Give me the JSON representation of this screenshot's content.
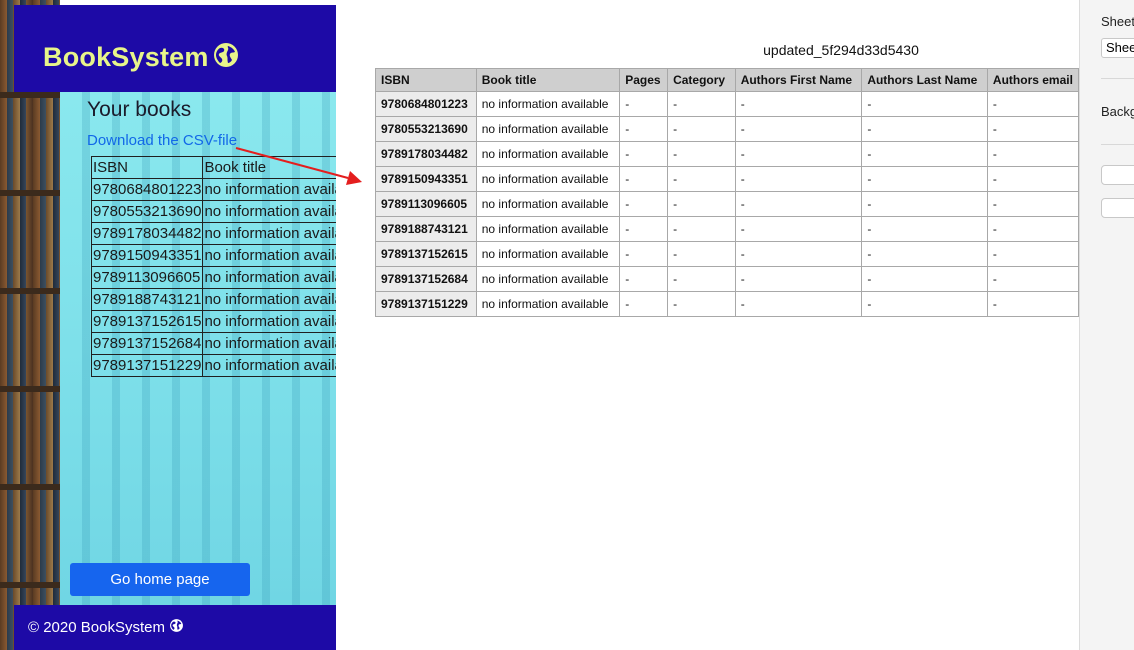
{
  "app": {
    "brand": "BookSystem",
    "heading": "Your books",
    "csv_link": "Download the CSV-file",
    "table": {
      "headers": [
        "ISBN",
        "Book title"
      ],
      "rows": [
        [
          "9780684801223",
          "no information available"
        ],
        [
          "9780553213690",
          "no information available"
        ],
        [
          "9789178034482",
          "no information available"
        ],
        [
          "9789150943351",
          "no information available"
        ],
        [
          "9789113096605",
          "no information available"
        ],
        [
          "9789188743121",
          "no information available"
        ],
        [
          "9789137152615",
          "no information available"
        ],
        [
          "9789137152684",
          "no information available"
        ],
        [
          "9789137151229",
          "no information available"
        ]
      ]
    },
    "home_button": "Go home page",
    "footer": "© 2020 BookSystem",
    "colors": {
      "header": "#1d0aa6",
      "brand_text": "#e8f58a",
      "link": "#1268e8",
      "button": "#1665ee",
      "hero": "#7ee0ea"
    },
    "icons": {
      "brand": "globe-icon",
      "footer": "globe-icon"
    }
  },
  "sheet": {
    "title": "updated_5f294d33d5430",
    "columns": [
      "ISBN",
      "Book title",
      "Pages",
      "Category",
      "Authors First Name",
      "Authors Last Name",
      "Authors email"
    ],
    "rows": [
      [
        "9780684801223",
        "no information available",
        "-",
        "-",
        "-",
        "-",
        "-"
      ],
      [
        "9780553213690",
        "no information available",
        "-",
        "-",
        "-",
        "-",
        "-"
      ],
      [
        "9789178034482",
        "no information available",
        "-",
        "-",
        "-",
        "-",
        "-"
      ],
      [
        "9789150943351",
        "no information available",
        "-",
        "-",
        "-",
        "-",
        "-"
      ],
      [
        "9789113096605",
        "no information available",
        "-",
        "-",
        "-",
        "-",
        "-"
      ],
      [
        "9789188743121",
        "no information available",
        "-",
        "-",
        "-",
        "-",
        "-"
      ],
      [
        "9789137152615",
        "no information available",
        "-",
        "-",
        "-",
        "-",
        "-"
      ],
      [
        "9789137152684",
        "no information available",
        "-",
        "-",
        "-",
        "-",
        "-"
      ],
      [
        "9789137151229",
        "no information available",
        "-",
        "-",
        "-",
        "-",
        "-"
      ]
    ]
  },
  "panel": {
    "sheet_label": "Sheet",
    "sheet_select": "Sheet",
    "background_label": "Background"
  },
  "annotation": {
    "arrow_color": "#e41e1e"
  }
}
